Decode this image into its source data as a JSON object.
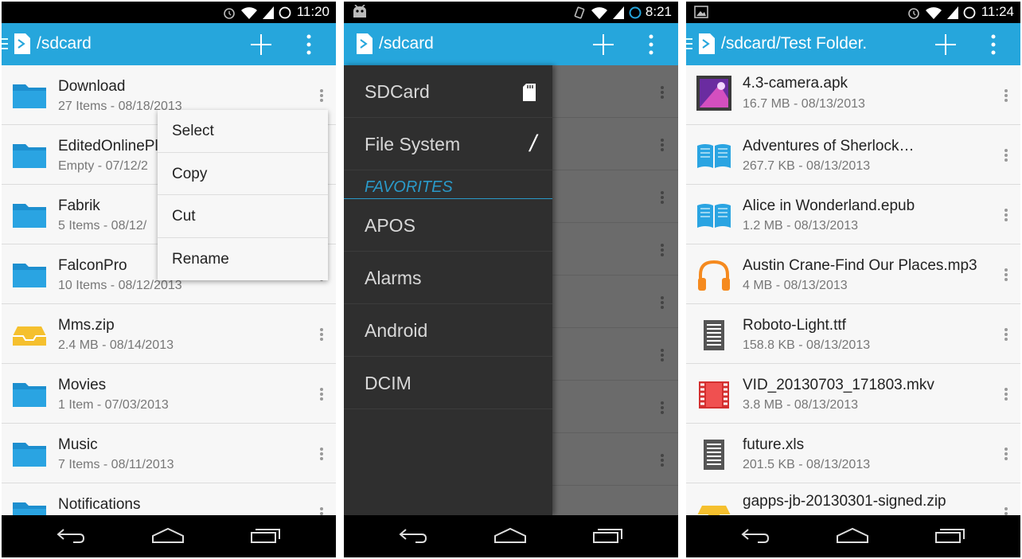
{
  "colors": {
    "accent": "#26a6dc",
    "folder": "#2196d8",
    "zip": "#f5c02e",
    "video": "#d32f2f",
    "audio": "#f58a1f"
  },
  "screens": [
    {
      "status": {
        "time": "11:20"
      },
      "title": "/sdcard",
      "items": [
        {
          "name": "Download",
          "meta": "27 Items - 08/18/2013",
          "icon": "folder-icon"
        },
        {
          "name": "EditedOnlinePl",
          "meta": "Empty - 07/12/2",
          "icon": "folder-icon"
        },
        {
          "name": "Fabrik",
          "meta": "5 Items - 08/12/",
          "icon": "folder-icon"
        },
        {
          "name": "FalconPro",
          "meta": "10 Items - 08/12/2013",
          "icon": "folder-icon"
        },
        {
          "name": "Mms.zip",
          "meta": "2.4 MB - 08/14/2013",
          "icon": "archive-icon"
        },
        {
          "name": "Movies",
          "meta": "1 Item - 07/03/2013",
          "icon": "folder-icon"
        },
        {
          "name": "Music",
          "meta": "7 Items - 08/11/2013",
          "icon": "folder-icon"
        },
        {
          "name": "Notifications",
          "meta": "",
          "icon": "folder-icon"
        }
      ],
      "context_menu": [
        "Select",
        "Copy",
        "Cut",
        "Rename"
      ]
    },
    {
      "status": {
        "time": "8:21"
      },
      "title": "/sdcard",
      "drawer": {
        "top_items": [
          {
            "label": "SDCard",
            "icon": "sdcard-icon"
          },
          {
            "label": "File System",
            "icon": "slash-icon",
            "icon_text": "/"
          }
        ],
        "favorites_header": "FAVORITES",
        "favorites": [
          "APOS",
          "Alarms",
          "Android",
          "DCIM"
        ]
      }
    },
    {
      "status": {
        "time": "11:24"
      },
      "title": "/sdcard/Test Folder.",
      "items": [
        {
          "name": "4.3-camera.apk",
          "meta": "16.7 MB - 08/13/2013",
          "icon": "apk-icon"
        },
        {
          "name": "Adventures of Sherlock…",
          "meta": "267.7 KB - 08/13/2013",
          "icon": "book-icon"
        },
        {
          "name": "Alice in Wonderland.epub",
          "meta": "1.2 MB - 08/13/2013",
          "icon": "book-icon"
        },
        {
          "name": "Austin Crane-Find Our Places.mp3",
          "meta": "4 MB - 08/13/2013",
          "icon": "headphones-icon"
        },
        {
          "name": "Roboto-Light.ttf",
          "meta": "158.8 KB - 08/13/2013",
          "icon": "document-icon"
        },
        {
          "name": "VID_20130703_171803.mkv",
          "meta": "3.8 MB - 08/13/2013",
          "icon": "video-icon"
        },
        {
          "name": "future.xls",
          "meta": "201.5 KB - 08/13/2013",
          "icon": "document-icon"
        },
        {
          "name": "gapps-jb-20130301-signed.zip",
          "meta": "",
          "icon": "archive-icon"
        }
      ]
    }
  ]
}
